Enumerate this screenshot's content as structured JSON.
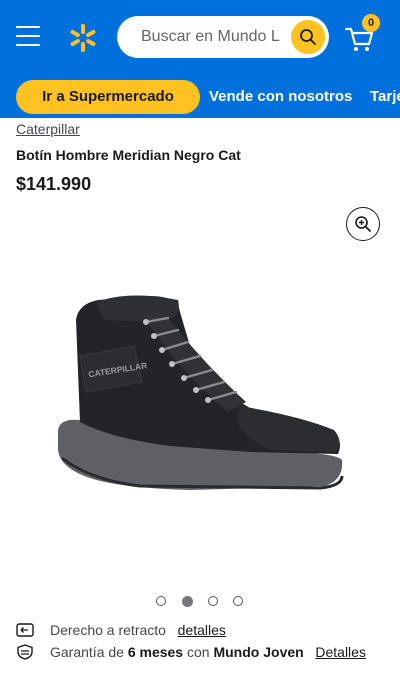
{
  "header": {
    "search_placeholder": "Buscar en Mundo Líder",
    "cart_count": "0",
    "brand_color": "#0071dc",
    "accent_color": "#ffc220"
  },
  "nav": {
    "supermarket_label": "Ir a Supermercado",
    "links": [
      "Vende con nosotros",
      "Tarje"
    ]
  },
  "product": {
    "brand": "Caterpillar",
    "title": "Botín Hombre Meridian Negro Cat",
    "price": "$141.990",
    "image_logo_text": "CATERPILLAR",
    "gallery": {
      "count": 4,
      "active_index": 1
    }
  },
  "info": {
    "withdrawal_label": "Derecho a retracto",
    "withdrawal_link": "detalles",
    "warranty_prefix": "Garantía de",
    "warranty_duration": "6 meses",
    "warranty_with": "con",
    "warranty_provider": "Mundo Joven",
    "warranty_link": "Detalles"
  }
}
